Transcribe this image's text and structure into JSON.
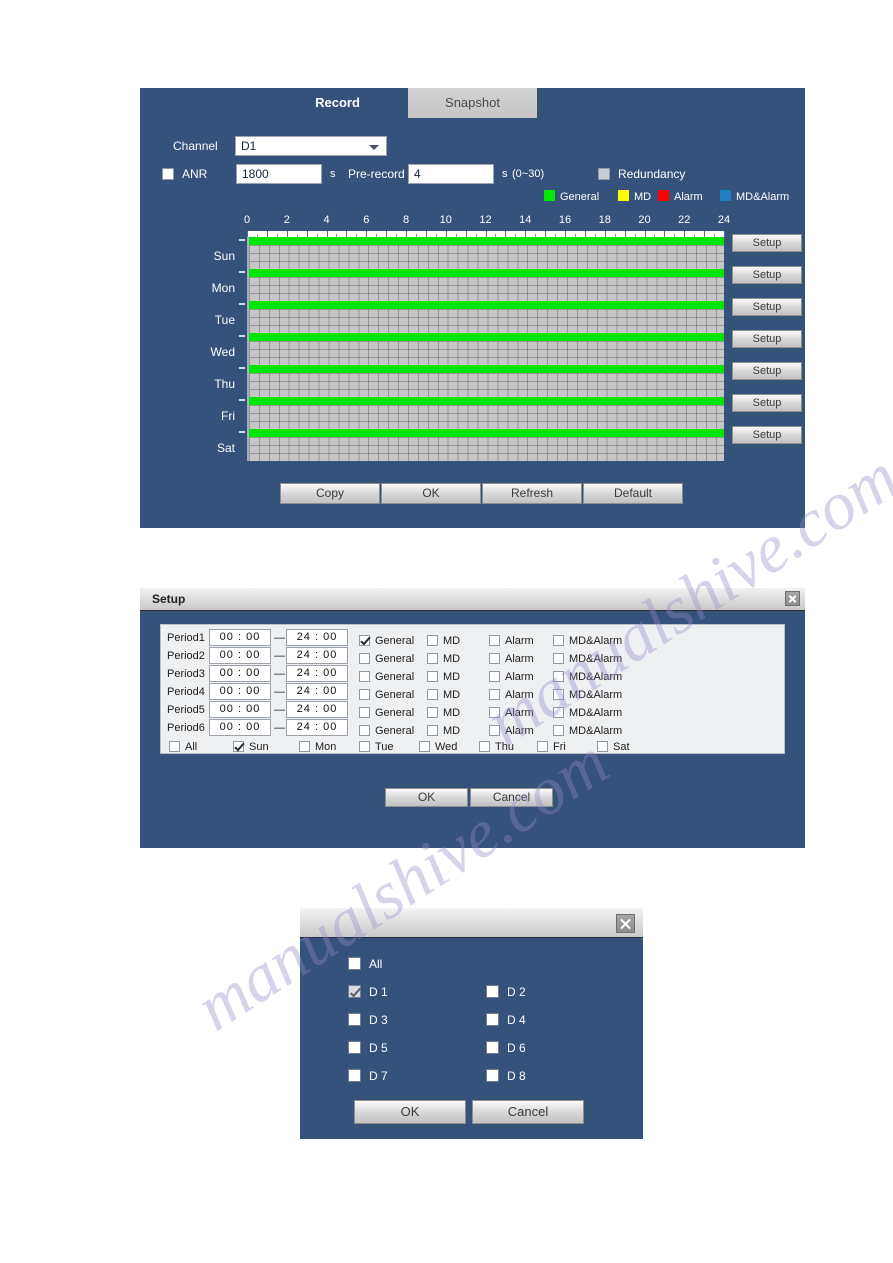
{
  "record_panel": {
    "tabs": [
      {
        "label": "Record",
        "active": true
      },
      {
        "label": "Snapshot",
        "active": false
      }
    ],
    "channel_label": "Channel",
    "channel_value": "D1",
    "anr_label": "ANR",
    "anr_checked": false,
    "anr_value": "1800",
    "anr_unit": "s",
    "prerecord_label": "Pre-record",
    "prerecord_value": "4",
    "prerecord_unit": "s",
    "prerecord_range": "(0~30)",
    "redundancy_label": "Redundancy",
    "redundancy_checked": false,
    "legend": [
      {
        "label": "General",
        "color": "#00e800"
      },
      {
        "label": "MD",
        "color": "#ffff00"
      },
      {
        "label": "Alarm",
        "color": "#ff0000"
      },
      {
        "label": "MD&Alarm",
        "color": "#1e7fc0"
      }
    ],
    "axis_ticks": [
      "0",
      "2",
      "4",
      "6",
      "8",
      "10",
      "12",
      "14",
      "16",
      "18",
      "20",
      "22",
      "24"
    ],
    "days": [
      {
        "label": "Sun",
        "setup_label": "Setup"
      },
      {
        "label": "Mon",
        "setup_label": "Setup"
      },
      {
        "label": "Tue",
        "setup_label": "Setup"
      },
      {
        "label": "Wed",
        "setup_label": "Setup"
      },
      {
        "label": "Thu",
        "setup_label": "Setup"
      },
      {
        "label": "Fri",
        "setup_label": "Setup"
      },
      {
        "label": "Sat",
        "setup_label": "Setup"
      }
    ],
    "buttons": {
      "copy": "Copy",
      "ok": "OK",
      "refresh": "Refresh",
      "default": "Default"
    }
  },
  "setup_dialog": {
    "title": "Setup",
    "close_icon": "close-icon",
    "periods": [
      {
        "name": "Period1",
        "start": "00 : 00",
        "end": "24 : 00",
        "general": true,
        "md": false,
        "alarm": false,
        "mdalarm": false
      },
      {
        "name": "Period2",
        "start": "00 : 00",
        "end": "24 : 00",
        "general": false,
        "md": false,
        "alarm": false,
        "mdalarm": false
      },
      {
        "name": "Period3",
        "start": "00 : 00",
        "end": "24 : 00",
        "general": false,
        "md": false,
        "alarm": false,
        "mdalarm": false
      },
      {
        "name": "Period4",
        "start": "00 : 00",
        "end": "24 : 00",
        "general": false,
        "md": false,
        "alarm": false,
        "mdalarm": false
      },
      {
        "name": "Period5",
        "start": "00 : 00",
        "end": "24 : 00",
        "general": false,
        "md": false,
        "alarm": false,
        "mdalarm": false
      },
      {
        "name": "Period6",
        "start": "00 : 00",
        "end": "24 : 00",
        "general": false,
        "md": false,
        "alarm": false,
        "mdalarm": false
      }
    ],
    "mode_labels": {
      "general": "General",
      "md": "MD",
      "alarm": "Alarm",
      "mdalarm": "MD&Alarm"
    },
    "dash": "—",
    "day_checkboxes": [
      {
        "label": "All",
        "checked": false
      },
      {
        "label": "Sun",
        "checked": true
      },
      {
        "label": "Mon",
        "checked": false
      },
      {
        "label": "Tue",
        "checked": false
      },
      {
        "label": "Wed",
        "checked": false
      },
      {
        "label": "Thu",
        "checked": false
      },
      {
        "label": "Fri",
        "checked": false
      },
      {
        "label": "Sat",
        "checked": false
      }
    ],
    "buttons": {
      "ok": "OK",
      "cancel": "Cancel"
    }
  },
  "channel_dialog": {
    "title": "",
    "close_icon": "close-icon",
    "items": [
      {
        "label": "All",
        "checked": false
      },
      {
        "label": "D 1",
        "checked": true
      },
      {
        "label": "D 2",
        "checked": false
      },
      {
        "label": "D 3",
        "checked": false
      },
      {
        "label": "D 4",
        "checked": false
      },
      {
        "label": "D 5",
        "checked": false
      },
      {
        "label": "D 6",
        "checked": false
      },
      {
        "label": "D 7",
        "checked": false
      },
      {
        "label": "D 8",
        "checked": false
      }
    ],
    "buttons": {
      "ok": "OK",
      "cancel": "Cancel"
    }
  },
  "watermark": {
    "line1": "manualshive.com",
    "line2": "manualshive.com"
  }
}
